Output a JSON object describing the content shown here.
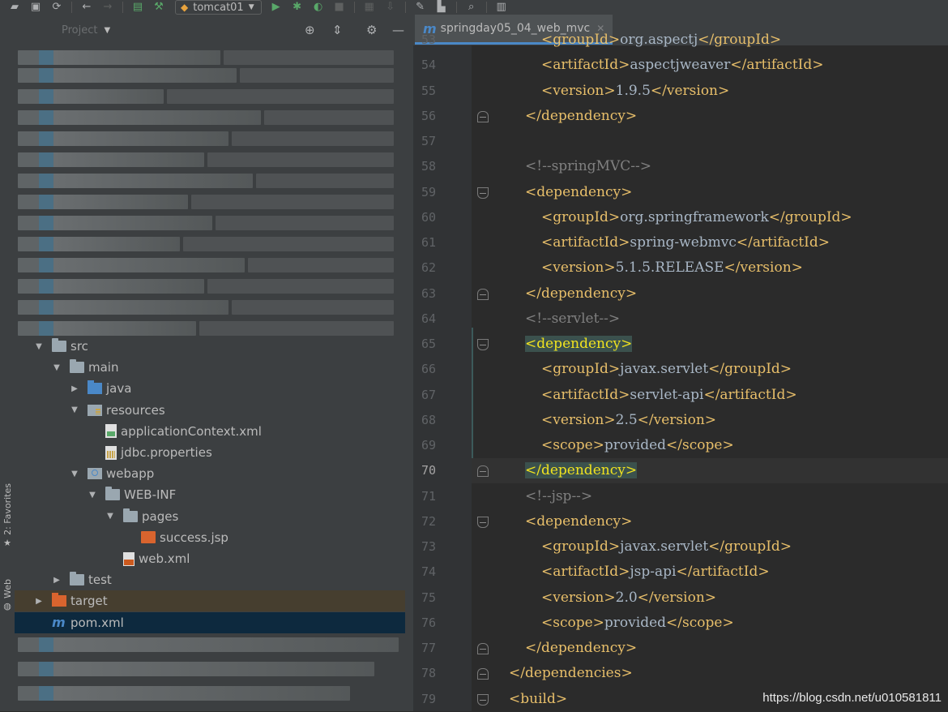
{
  "toolbar": {
    "run_config": "tomcat01",
    "icons": [
      "open-icon",
      "save-icon",
      "sync-icon",
      "back-icon",
      "forward-icon",
      "run-config-icon",
      "build-icon",
      "run-icon",
      "debug-icon",
      "coverage-icon",
      "stop-icon",
      "project-structure-icon",
      "sdk-icon",
      "settings-icon",
      "frame-icon",
      "search-icon",
      "structure-icon"
    ]
  },
  "project_pane": {
    "title": "Project",
    "tree": [
      {
        "label": "src",
        "depth": 0,
        "expanded": true,
        "icon": "folder-gray"
      },
      {
        "label": "main",
        "depth": 1,
        "expanded": true,
        "icon": "folder-gray"
      },
      {
        "label": "java",
        "depth": 2,
        "expanded": false,
        "icon": "folder-blue"
      },
      {
        "label": "resources",
        "depth": 2,
        "expanded": true,
        "icon": "folder-res"
      },
      {
        "label": "applicationContext.xml",
        "depth": 3,
        "icon": "file-xml"
      },
      {
        "label": "jdbc.properties",
        "depth": 3,
        "icon": "file-props"
      },
      {
        "label": "webapp",
        "depth": 2,
        "expanded": true,
        "icon": "folder-web"
      },
      {
        "label": "WEB-INF",
        "depth": 3,
        "expanded": true,
        "icon": "folder-gray"
      },
      {
        "label": "pages",
        "depth": 4,
        "expanded": true,
        "icon": "folder-gray"
      },
      {
        "label": "success.jsp",
        "depth": 5,
        "icon": "file-jsp"
      },
      {
        "label": "web.xml",
        "depth": 4,
        "icon": "file-web"
      },
      {
        "label": "test",
        "depth": 1,
        "expanded": false,
        "icon": "folder-gray"
      },
      {
        "label": "target",
        "depth": 0,
        "expanded": false,
        "icon": "folder-orange"
      },
      {
        "label": "pom.xml",
        "depth": 0,
        "icon": "pom-m"
      }
    ]
  },
  "side_tabs": {
    "favorites": "2: Favorites",
    "web": "Web"
  },
  "editor": {
    "tab_label": "springday05_04_web_mvc",
    "tab_letter": "m",
    "current_line": "70",
    "lines": [
      {
        "n": "53",
        "indent": 2,
        "parts": [
          [
            "tag",
            "<groupId>"
          ],
          [
            "txt",
            "org.aspectj"
          ],
          [
            "tag",
            "</groupId>"
          ]
        ]
      },
      {
        "n": "54",
        "indent": 2,
        "parts": [
          [
            "tag",
            "<artifactId>"
          ],
          [
            "txt",
            "aspectjweaver"
          ],
          [
            "tag",
            "</artifactId>"
          ]
        ]
      },
      {
        "n": "55",
        "indent": 2,
        "parts": [
          [
            "tag",
            "<version>"
          ],
          [
            "txt",
            "1.9.5"
          ],
          [
            "tag",
            "</version>"
          ]
        ]
      },
      {
        "n": "56",
        "indent": 1,
        "parts": [
          [
            "tag",
            "</dependency>"
          ]
        ]
      },
      {
        "n": "57",
        "indent": 0,
        "parts": []
      },
      {
        "n": "58",
        "indent": 1,
        "parts": [
          [
            "cmt",
            "<!--springMVC-->"
          ]
        ]
      },
      {
        "n": "59",
        "indent": 1,
        "parts": [
          [
            "tag",
            "<dependency>"
          ]
        ]
      },
      {
        "n": "60",
        "indent": 2,
        "parts": [
          [
            "tag",
            "<groupId>"
          ],
          [
            "txt",
            "org.springframework"
          ],
          [
            "tag",
            "</groupId>"
          ]
        ]
      },
      {
        "n": "61",
        "indent": 2,
        "parts": [
          [
            "tag",
            "<artifactId>"
          ],
          [
            "txt",
            "spring-webmvc"
          ],
          [
            "tag",
            "</artifactId>"
          ]
        ]
      },
      {
        "n": "62",
        "indent": 2,
        "parts": [
          [
            "tag",
            "<version>"
          ],
          [
            "txt",
            "5.1.5.RELEASE"
          ],
          [
            "tag",
            "</version>"
          ]
        ]
      },
      {
        "n": "63",
        "indent": 1,
        "parts": [
          [
            "tag",
            "</dependency>"
          ]
        ]
      },
      {
        "n": "64",
        "indent": 1,
        "parts": [
          [
            "cmt",
            "<!--servlet-->"
          ]
        ]
      },
      {
        "n": "65",
        "indent": 1,
        "parts": [
          [
            "match",
            "<dependency>"
          ]
        ]
      },
      {
        "n": "66",
        "indent": 2,
        "parts": [
          [
            "tag",
            "<groupId>"
          ],
          [
            "txt",
            "javax.servlet"
          ],
          [
            "tag",
            "</groupId>"
          ]
        ]
      },
      {
        "n": "67",
        "indent": 2,
        "parts": [
          [
            "tag",
            "<artifactId>"
          ],
          [
            "txt",
            "servlet-api"
          ],
          [
            "tag",
            "</artifactId>"
          ]
        ]
      },
      {
        "n": "68",
        "indent": 2,
        "parts": [
          [
            "tag",
            "<version>"
          ],
          [
            "txt",
            "2.5"
          ],
          [
            "tag",
            "</version>"
          ]
        ]
      },
      {
        "n": "69",
        "indent": 2,
        "parts": [
          [
            "tag",
            "<scope>"
          ],
          [
            "txt",
            "provided"
          ],
          [
            "tag",
            "</scope>"
          ]
        ]
      },
      {
        "n": "70",
        "indent": 1,
        "parts": [
          [
            "match",
            "</dependency>"
          ]
        ]
      },
      {
        "n": "71",
        "indent": 1,
        "parts": [
          [
            "cmt",
            "<!--jsp-->"
          ]
        ]
      },
      {
        "n": "72",
        "indent": 1,
        "parts": [
          [
            "tag",
            "<dependency>"
          ]
        ]
      },
      {
        "n": "73",
        "indent": 2,
        "parts": [
          [
            "tag",
            "<groupId>"
          ],
          [
            "txt",
            "javax.servlet"
          ],
          [
            "tag",
            "</groupId>"
          ]
        ]
      },
      {
        "n": "74",
        "indent": 2,
        "parts": [
          [
            "tag",
            "<artifactId>"
          ],
          [
            "txt",
            "jsp-api"
          ],
          [
            "tag",
            "</artifactId>"
          ]
        ]
      },
      {
        "n": "75",
        "indent": 2,
        "parts": [
          [
            "tag",
            "<version>"
          ],
          [
            "txt",
            "2.0"
          ],
          [
            "tag",
            "</version>"
          ]
        ]
      },
      {
        "n": "76",
        "indent": 2,
        "parts": [
          [
            "tag",
            "<scope>"
          ],
          [
            "txt",
            "provided"
          ],
          [
            "tag",
            "</scope>"
          ]
        ]
      },
      {
        "n": "77",
        "indent": 1,
        "parts": [
          [
            "tag",
            "</dependency>"
          ]
        ]
      },
      {
        "n": "78",
        "indent": 0,
        "parts": [
          [
            "tag",
            "</dependencies>"
          ]
        ]
      },
      {
        "n": "79",
        "indent": 0,
        "parts": [
          [
            "tag",
            "<build>"
          ]
        ]
      }
    ]
  },
  "watermark": "https://blog.csdn.net/u010581811",
  "colors": {
    "tag": "#e8bf6a",
    "text": "#a9b7c6",
    "comment": "#808080",
    "line_number": "#606366",
    "selection": "#0d293e"
  }
}
